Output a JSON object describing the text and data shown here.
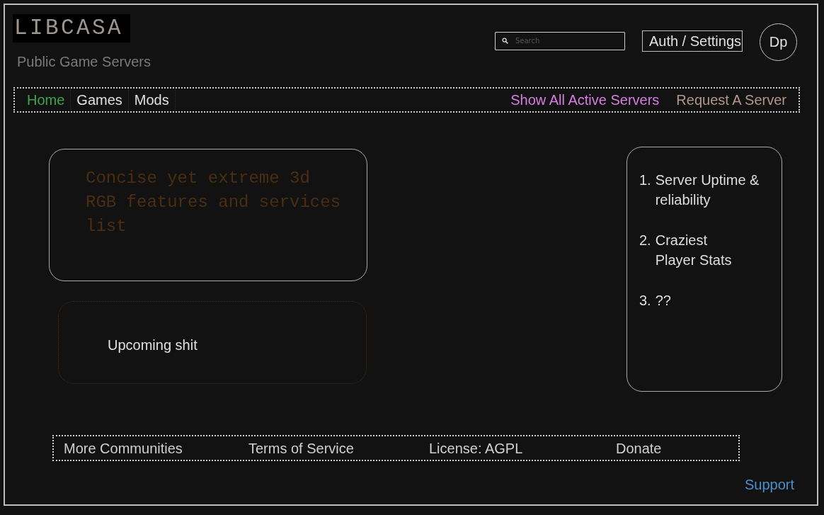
{
  "header": {
    "logo": "LIBCASA",
    "subtitle": "Public Game Servers",
    "search": {
      "placeholder": "Search"
    },
    "auth_button": "Auth / Settings",
    "avatar": "Dp"
  },
  "nav": {
    "items": [
      {
        "label": "Home",
        "selected": true
      },
      {
        "label": "Games",
        "selected": false
      },
      {
        "label": "Mods",
        "selected": false
      }
    ],
    "links": [
      {
        "label": "Show All Active Servers",
        "color": "#d67fe0"
      },
      {
        "label": "Request A Server",
        "color": "#b3978b"
      }
    ]
  },
  "feature_card": {
    "text": "Concise yet extreme 3d RGB features and services list"
  },
  "upcoming_card": {
    "text": "Upcoming shit"
  },
  "highlights": [
    {
      "number": "1.",
      "text": "Server Uptime &\nreliability"
    },
    {
      "number": "2.",
      "text": "Craziest\nPlayer Stats"
    },
    {
      "number": "3.",
      "text": "??"
    }
  ],
  "footer": {
    "links": [
      "More Communities",
      "Terms of Service",
      "License: AGPL",
      "Donate"
    ]
  },
  "support_link": "Support"
}
